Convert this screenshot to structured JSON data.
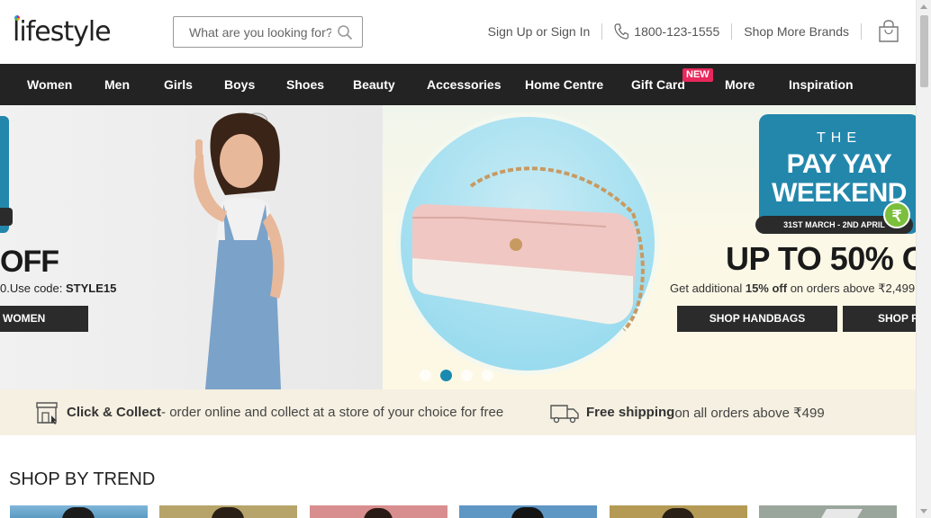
{
  "header": {
    "logo": "lifestyle",
    "search_placeholder": "What are you looking for?",
    "links": {
      "signin": "Sign Up or Sign In",
      "phone": "1800-123-1555",
      "brands": "Shop More Brands"
    }
  },
  "nav": {
    "items": [
      "Women",
      "Men",
      "Girls",
      "Boys",
      "Shoes",
      "Beauty",
      "Accessories",
      "Home Centre",
      "Gift Card",
      "More",
      "Inspiration"
    ],
    "new_badge": "NEW"
  },
  "banner": {
    "left": {
      "headline": "OFF",
      "code_prefix": "0.Use code: ",
      "code": "STYLE15",
      "button": "WOMEN"
    },
    "right": {
      "the": "THE",
      "title_line1": "PAY YAY",
      "title_line2": "WEEKEND",
      "dates": "31ST MARCH - 2ND APRIL",
      "coin": "₹",
      "headline": "UP TO 50% O",
      "addl_prefix": "Get additional ",
      "addl_bold": "15% off",
      "addl_suffix": " on orders above ₹2,499",
      "button_handbags": "SHOP HANDBAGS",
      "button_second": "SHOP F"
    },
    "active_dot": 2,
    "dot_count": 4
  },
  "strip": {
    "click_collect_bold": "Click & Collect",
    "click_collect_text": " - order online and collect at a store of your choice for free",
    "shipping_bold": "Free shipping",
    "shipping_text": " on all orders above ₹499"
  },
  "trend": {
    "title": "SHOP BY TREND"
  },
  "colors": {
    "nav_bg": "#232323",
    "accent_blue": "#2387ac",
    "new_badge": "#e8285c",
    "strip_bg": "#f5f0e1"
  }
}
